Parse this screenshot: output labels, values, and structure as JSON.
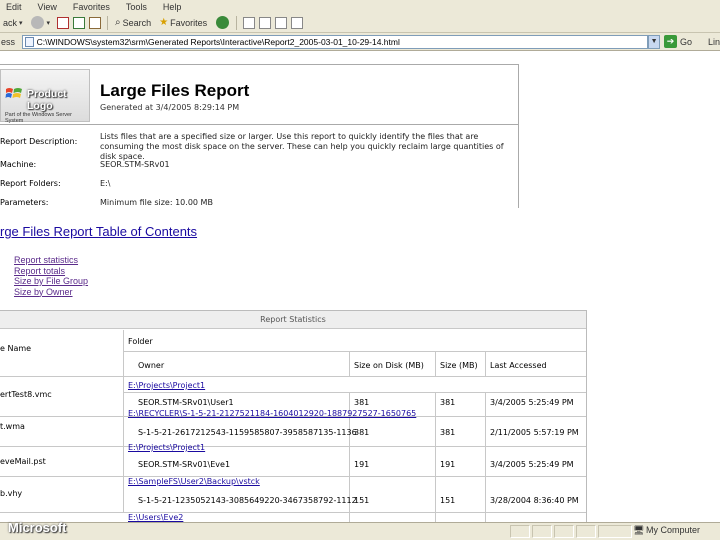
{
  "menu": [
    "Edit",
    "View",
    "Favorites",
    "Tools",
    "Help"
  ],
  "toolbar": {
    "back": "ack",
    "search": "Search",
    "favorites": "Favorites"
  },
  "address": {
    "label": "ess",
    "url": "C:\\WINDOWS\\system32\\srm\\Generated Reports\\Interactive\\Report2_2005-03-01_10-29-14.html",
    "go": "Go",
    "links": "Lin"
  },
  "header": {
    "logo_text": "Product Logo",
    "logo_subtext": "Part of the Windows Server System",
    "title": "Large Files Report",
    "generated": "Generated at 3/4/2005 8:29:14 PM",
    "description_label": "Report Description:",
    "description": "Lists files that are a specified size or larger. Use this report to quickly identify the files that are consuming the most disk space on the server. These can help you quickly reclaim large quantities of disk space.",
    "machine_label": "Machine:",
    "machine": "SEOR.STM-SRv01",
    "folders_label": "Report Folders:",
    "folders": "E:\\",
    "parameters_label": "Parameters:",
    "parameters": "Minimum file size: 10.00 MB"
  },
  "toc": {
    "title": "rge Files Report Table of Contents",
    "links": [
      "Report statistics",
      "Report totals",
      "Size by File Group",
      "Size by Owner"
    ]
  },
  "stats": {
    "title": "Report Statistics",
    "col_filename": "e Name",
    "col_folder": "Folder",
    "col_owner": "Owner",
    "col_size_disk": "Size on Disk (MB)",
    "col_size": "Size (MB)",
    "col_last_accessed": "Last Accessed",
    "rows": [
      {
        "name": "ertTest8.vmc",
        "folder": "E:\\Projects\\Project1",
        "owner": "SEOR.STM-SRv01\\User1",
        "size_disk": "381",
        "size": "381",
        "accessed": "3/4/2005 5:25:49 PM"
      },
      {
        "name": "t.wma",
        "folder": "E:\\RECYCLER\\S-1-5-21-2127521184-1604012920-1887927527-1650765",
        "owner": "S-1-5-21-2617212543-1159585807-3958587135-1136",
        "size_disk": "381",
        "size": "381",
        "accessed": "2/11/2005 5:57:19 PM"
      },
      {
        "name": "eveMail.pst",
        "folder": "E:\\Projects\\Project1",
        "owner": "SEOR.STM-SRv01\\Eve1",
        "size_disk": "191",
        "size": "191",
        "accessed": "3/4/2005 5:25:49 PM"
      },
      {
        "name": "b.vhy",
        "folder": "E:\\SampleFS\\User2\\Backup\\vstck",
        "owner": "S-1-5-21-1235052143-3085649220-3467358792-1112",
        "size_disk": "151",
        "size": "151",
        "accessed": "3/28/2004 8:36:40 PM"
      },
      {
        "name": "",
        "folder": "E:\\Users\\Eve2",
        "owner": "",
        "size_disk": "",
        "size": "",
        "accessed": ""
      }
    ]
  },
  "statusbar": {
    "zone": "My Computer"
  },
  "watermark": "Microsoft"
}
